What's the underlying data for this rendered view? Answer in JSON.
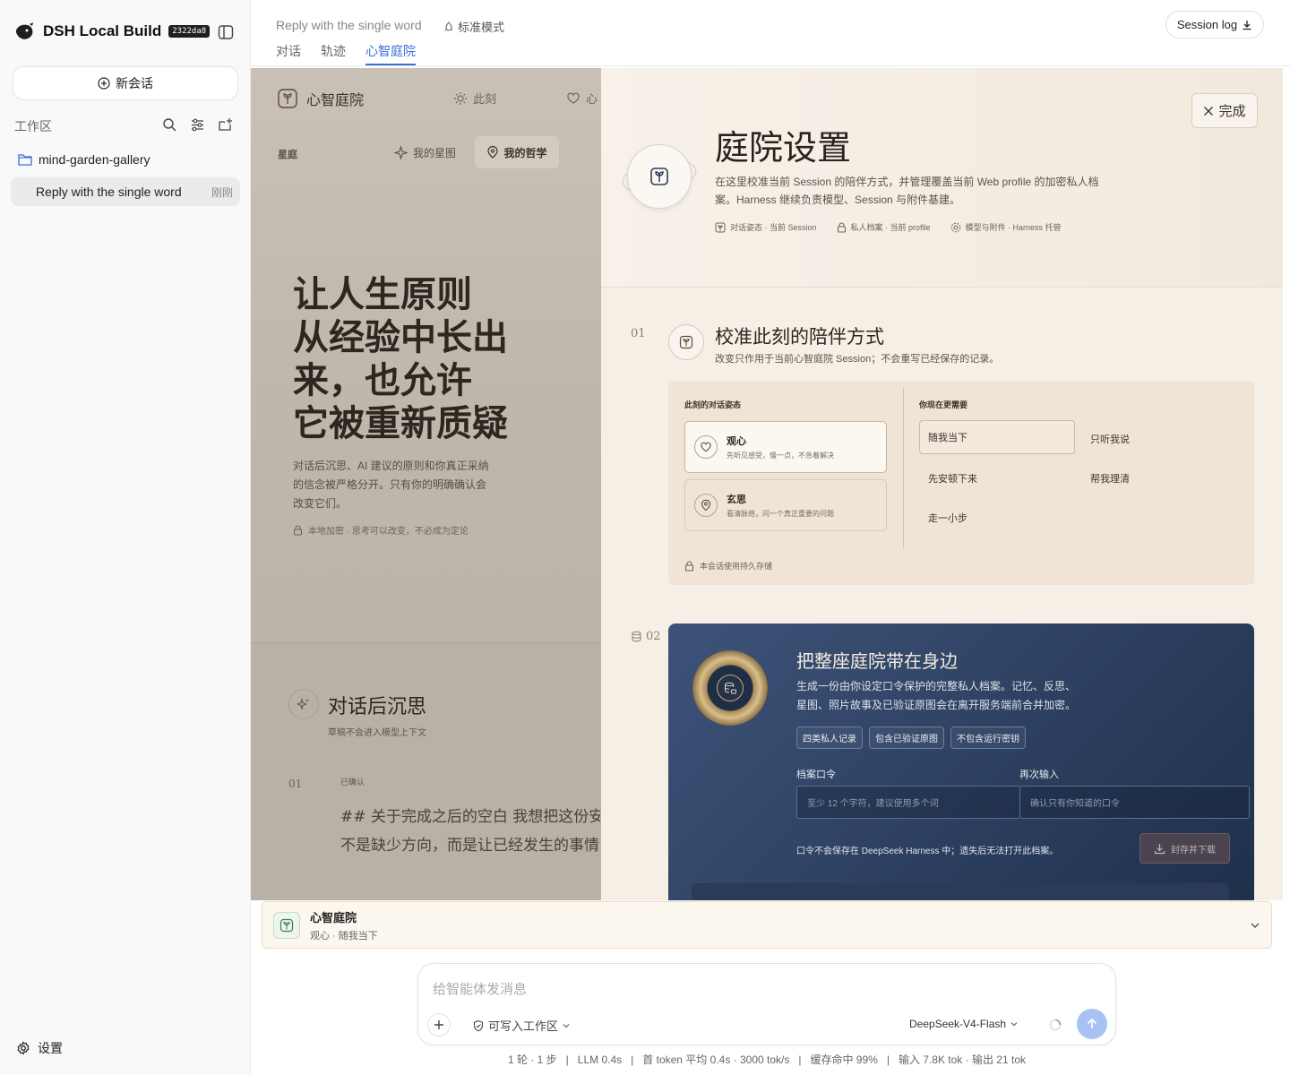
{
  "app": {
    "title": "DSH Local Build",
    "build": "2322da8"
  },
  "sidebar": {
    "new_chat": "新会话",
    "workspace_label": "工作区",
    "folder": "mind-garden-gallery",
    "session": {
      "title": "Reply with the single word",
      "time": "刚刚"
    },
    "settings": "设置"
  },
  "header": {
    "session_title": "Reply with the single word",
    "mode": "标准模式",
    "tabs": [
      {
        "label": "对话"
      },
      {
        "label": "轨迹"
      },
      {
        "label": "心智庭院",
        "active": true
      }
    ],
    "session_log": "Session log"
  },
  "garden": {
    "logo": "心智庭院",
    "nav": [
      "此刻",
      "心"
    ],
    "sub_label": "星庭",
    "sub_nav": [
      "我的星图",
      "我的哲学"
    ],
    "hero": [
      "让人生原则",
      "从经验中长出",
      "来，也允许",
      "它被重新质疑"
    ],
    "hero_desc": "对话后沉思、AI 建议的原则和你真正采纳的信念被严格分开。只有你的明确确认会改变它们。",
    "hero_note": "本地加密 · 思考可以改变，不必成为定论",
    "post_chat": {
      "title": "对话后沉思",
      "subtitle": "草稿不会进入模型上下文",
      "num": "01",
      "confirmed": "已确认",
      "lines": [
        "## 关于完成之后的空白 我想把这份安静留久一",
        "不是缺少方向，而是让已经发生的事情有机会"
      ]
    }
  },
  "panel": {
    "done": "完成",
    "title": "庭院设置",
    "desc": "在这里校准当前 Session 的陪伴方式，并管理覆盖当前 Web profile 的加密私人档案。Harness 继续负责模型、Session 与附件基建。",
    "tags": [
      "对话姿态 · 当前 Session",
      "私人档案 · 当前 profile",
      "模型与附件 · Harness 托管"
    ],
    "section1": {
      "num": "01",
      "title": "校准此刻的陪伴方式",
      "subtitle": "改变只作用于当前心智庭院 Session；不会重写已经保存的记录。",
      "left_heading": "此刻的对话姿态",
      "moods": [
        {
          "name": "观心",
          "desc": "先听见感受，慢一点，不急着解决"
        },
        {
          "name": "玄思",
          "desc": "看清脉络，问一个真正重要的问题"
        }
      ],
      "right_heading": "你现在更需要",
      "needs": [
        "随我当下",
        "只听我说",
        "先安顿下来",
        "帮我理清",
        "走一小步"
      ],
      "footer": "本会话使用持久存储"
    },
    "section2": {
      "num": "02",
      "title": "把整座庭院带在身边",
      "desc": "生成一份由你设定口令保护的完整私人档案。记忆、反思、星图、照片故事及已验证原图会在离开服务端前合并加密。",
      "chips": [
        "四类私人记录",
        "包含已验证原图",
        "不包含运行密钥"
      ],
      "pass_label": "档案口令",
      "pass_placeholder": "至少 12 个字符，建议使用多个词",
      "repeat_label": "再次输入",
      "repeat_placeholder": "确认只有你知道的口令",
      "note": "口令不会保存在 DeepSeek Harness 中；遗失后无法打开此档案。",
      "button": "封存并下载"
    }
  },
  "context": {
    "title": "心智庭院",
    "subtitle": "观心 · 随我当下"
  },
  "composer": {
    "placeholder": "给智能体发消息",
    "workspace_mode": "可写入工作区",
    "model": "DeepSeek-V4-Flash"
  },
  "stats": "1 轮 · 1 步   |   LLM 0.4s   |   首 token 平均 0.4s · 3000 tok/s   |   缓存命中 99%   |   输入 7.8K tok · 输出 21 tok",
  "colors": {
    "accent": "#3a6fd8",
    "panel_bg": "#f6efe6",
    "archive_card": "#2c3f60",
    "send_button": "#a8c2f5"
  }
}
